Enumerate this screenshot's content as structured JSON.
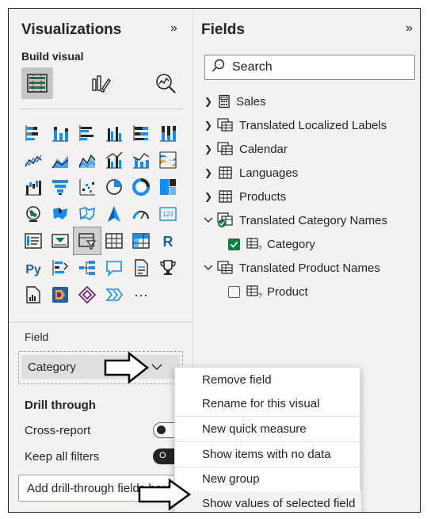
{
  "visualizations": {
    "title": "Visualizations",
    "collapse_glyph": "»",
    "build_visual_label": "Build visual",
    "modes": [
      {
        "icon": "build-visual-grid-icon",
        "active": true
      },
      {
        "icon": "format-visual-brush-icon",
        "active": false
      },
      {
        "icon": "analytics-magnifier-icon",
        "active": false
      }
    ],
    "visual_types": [
      "stacked-bar-icon",
      "stacked-column-icon",
      "clustered-bar-icon",
      "clustered-column-icon",
      "100pct-stacked-bar-icon",
      "100pct-stacked-column-icon",
      "line-chart-icon",
      "area-chart-icon",
      "stacked-area-icon",
      "line-clustered-column-icon",
      "line-stacked-column-icon",
      "ribbon-chart-icon",
      "waterfall-icon",
      "funnel-icon",
      "scatter-icon",
      "pie-icon",
      "donut-icon",
      "treemap-icon",
      "map-icon",
      "filled-map-icon",
      "shape-map-icon",
      "azure-map-icon",
      "gauge-icon",
      "card-icon",
      "multi-row-card-icon",
      "kpi-icon",
      "slicer-icon",
      "table-icon",
      "matrix-icon",
      "r-visual-icon",
      "python-visual-icon",
      "key-influencers-icon",
      "decomposition-tree-icon",
      "qa-icon",
      "smart-narrative-icon",
      "trophy-icon",
      "paginated-report-icon",
      "power-apps-icon",
      "power-automate-icon",
      "more-visuals-icon",
      "",
      ""
    ],
    "more_glyph": "···",
    "field_label": "Field",
    "field_value": "Category",
    "drill_through_label": "Drill through",
    "cross_report_label": "Cross-report",
    "keep_all_filters_label": "Keep all filters",
    "keep_all_filters_toggle": "O",
    "add_drill_label": "Add drill-through fields here"
  },
  "fields_pane": {
    "title": "Fields",
    "collapse_glyph": "»",
    "search_placeholder": "Search",
    "tables": [
      {
        "name": "Sales",
        "icon": "calculator-icon",
        "expanded": false
      },
      {
        "name": "Translated Localized Labels",
        "icon": "table-multi-icon",
        "expanded": false
      },
      {
        "name": "Calendar",
        "icon": "table-multi-icon",
        "expanded": false
      },
      {
        "name": "Languages",
        "icon": "table-icon",
        "expanded": false
      },
      {
        "name": "Products",
        "icon": "table-icon",
        "expanded": false
      },
      {
        "name": "Translated Category Names",
        "icon": "table-multi-icon",
        "expanded": true
      },
      {
        "name": "Translated Product Names",
        "icon": "table-multi-icon",
        "expanded": true
      }
    ],
    "category_field": {
      "name": "Category",
      "checked": true
    },
    "product_field": {
      "name": "Product",
      "checked": false
    }
  },
  "context_menu": {
    "items": [
      "Remove field",
      "Rename for this visual",
      "New quick measure",
      "Show items with no data",
      "New group",
      "Show values of selected field"
    ]
  },
  "colors": {
    "pane_bg": "#f3f2f1",
    "accent_teal": "#118dff",
    "check_green": "#107c41",
    "border": "#1f1f1f"
  }
}
